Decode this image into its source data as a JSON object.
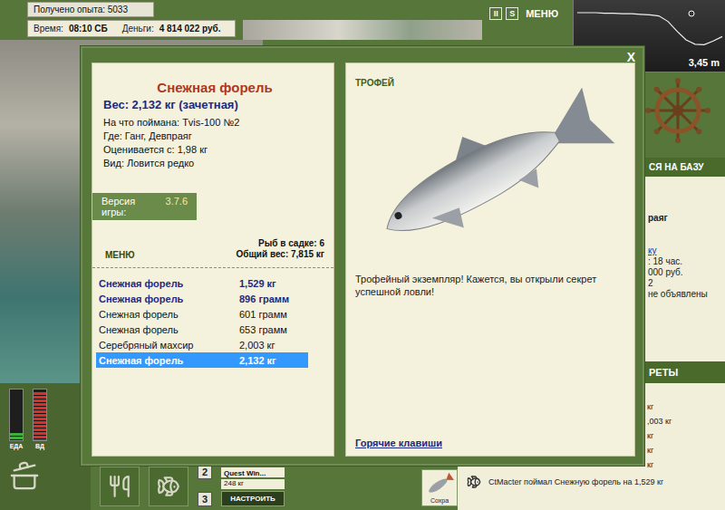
{
  "hud": {
    "experience": "Получено опыта: 5033",
    "time_label": "Время:",
    "time": "08:10 СБ",
    "money_label": "Деньги:",
    "money": "4 814 022 руб.",
    "buttons": [
      "II",
      "S"
    ],
    "menu": "МЕНЮ"
  },
  "depth_chart": {
    "values": [
      0.5,
      0.5,
      0.5,
      0.55,
      0.55,
      0.6,
      0.6,
      0.65,
      0.7,
      0.8,
      1.3,
      2.2,
      3.0,
      3.4,
      3.45,
      3.1,
      2.7
    ],
    "reading": "3,45 m"
  },
  "dialog": {
    "close": "X",
    "fish": {
      "name": "Снежная форель",
      "weight": "Вес: 2,132 кг (зачетная)",
      "details": [
        "На что поймана: Tvis-100 №2",
        "Где: Ганг, Девпраяг",
        "Оценивается с: 1,98 кг",
        "Вид: Ловится редко"
      ]
    },
    "version_label": "Версия игры:",
    "version": "3.7.6",
    "menu": "МЕНЮ",
    "keepnet_count": "Рыб в садке: 6",
    "keepnet_weight": "Общий вес: 7,815 кг",
    "catches": [
      {
        "name": "Снежная форель",
        "weight": "1,529 кг",
        "bold": true,
        "selected": false
      },
      {
        "name": "Снежная форель",
        "weight": "896 грамм",
        "bold": true,
        "selected": false
      },
      {
        "name": "Снежная форель",
        "weight": "601 грамм",
        "bold": false,
        "selected": false
      },
      {
        "name": "Снежная форель",
        "weight": "653 грамм",
        "bold": false,
        "selected": false
      },
      {
        "name": "Серебряный махсир",
        "weight": "2,003 кг",
        "bold": false,
        "selected": false
      },
      {
        "name": "Снежная форель",
        "weight": "2,132 кг",
        "bold": true,
        "selected": true
      }
    ],
    "trophy": {
      "label": "ТРОФЕЙ",
      "message": "Трофейный экземпляр! Кажется, вы открыли секрет успешной ловли!",
      "hotkeys": "Горячие клавиши"
    }
  },
  "sidebar": {
    "base_button": "СЯ НА БАЗУ",
    "info_lines": [
      {
        "text": "раяг",
        "kind": "bold"
      },
      {
        "text": "ку",
        "kind": "link"
      },
      {
        "text": ": 18 час.",
        "kind": "plain"
      },
      {
        "text": "000 руб.",
        "kind": "plain"
      },
      {
        "text": "2",
        "kind": "plain"
      },
      {
        "text": "не объявлены",
        "kind": "plain"
      }
    ],
    "records_header": "РЕТЫ"
  },
  "gauges": [
    {
      "label": "ЕДА",
      "level": 0.15,
      "color": "#3fae3f"
    },
    {
      "label": "ВД",
      "level": 0.95,
      "color": "#d9302a"
    }
  ],
  "toolbar": {
    "slots": [
      "2",
      "3"
    ],
    "quest": {
      "title": "Quest Win...",
      "weight": "248 кг",
      "button": "НАСТРОИТЬ"
    },
    "thumb_label": "Сохра"
  },
  "records": {
    "cut_rows": [
      "кг",
      ",003 кг",
      "кг",
      "кг",
      "кг"
    ],
    "last": "CtMacter поймал Снежную форель на 1,529 кг"
  }
}
